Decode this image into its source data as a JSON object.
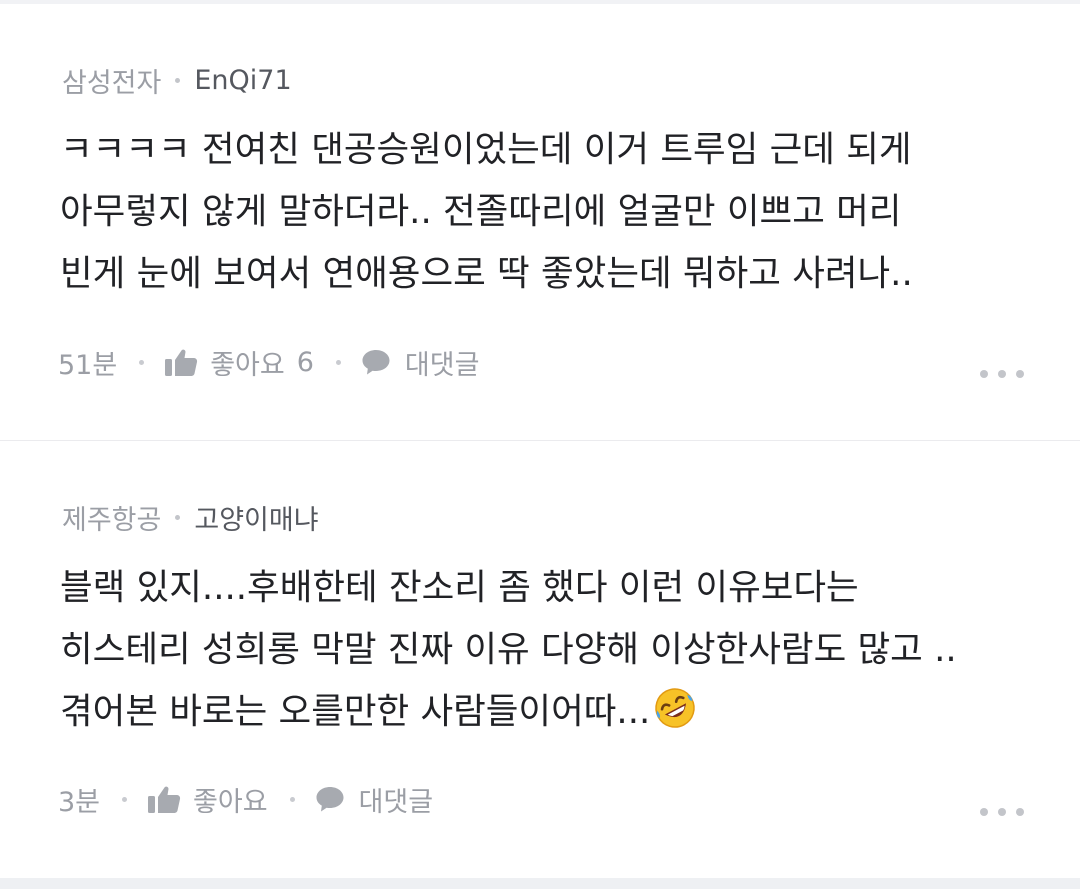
{
  "comments": [
    {
      "company": "삼성전자",
      "nickname": "EnQi71",
      "lines": [
        "ㅋㅋㅋㅋ 전여친 댄공승원이었는데 이거 트루임 근데 되게",
        "아무렇지 않게 말하더라.. 전졸따리에 얼굴만 이쁘고 머리",
        "빈게 눈에 보여서 연애용으로 딱 좋았는데 뭐하고 사려나.."
      ],
      "time": "51분",
      "like_label": "좋아요",
      "like_count": "6",
      "reply_label": "대댓글"
    },
    {
      "company": "제주항공",
      "nickname": "고양이매냐",
      "lines": [
        "블랙 있지....후배한테 잔소리 좀 했다 이런 이유보다는",
        "히스테리 성희롱 막말 진짜 이유 다양해 이상한사람도 많고 ..",
        "겪어본 바로는  오를만한 사람들이어따..."
      ],
      "emoji": "rolling-on-floor-laughing-emoji",
      "time": "3분",
      "like_label": "좋아요",
      "like_count": "",
      "reply_label": "대댓글"
    }
  ],
  "icons": {
    "like": "thumbs-up-icon",
    "reply": "speech-bubble-icon",
    "more": "more-dots-icon"
  },
  "colors": {
    "meta_gray": "#9b9ea5",
    "nickname": "#55585f",
    "body_text": "#212226",
    "divider": "#ebebee"
  }
}
